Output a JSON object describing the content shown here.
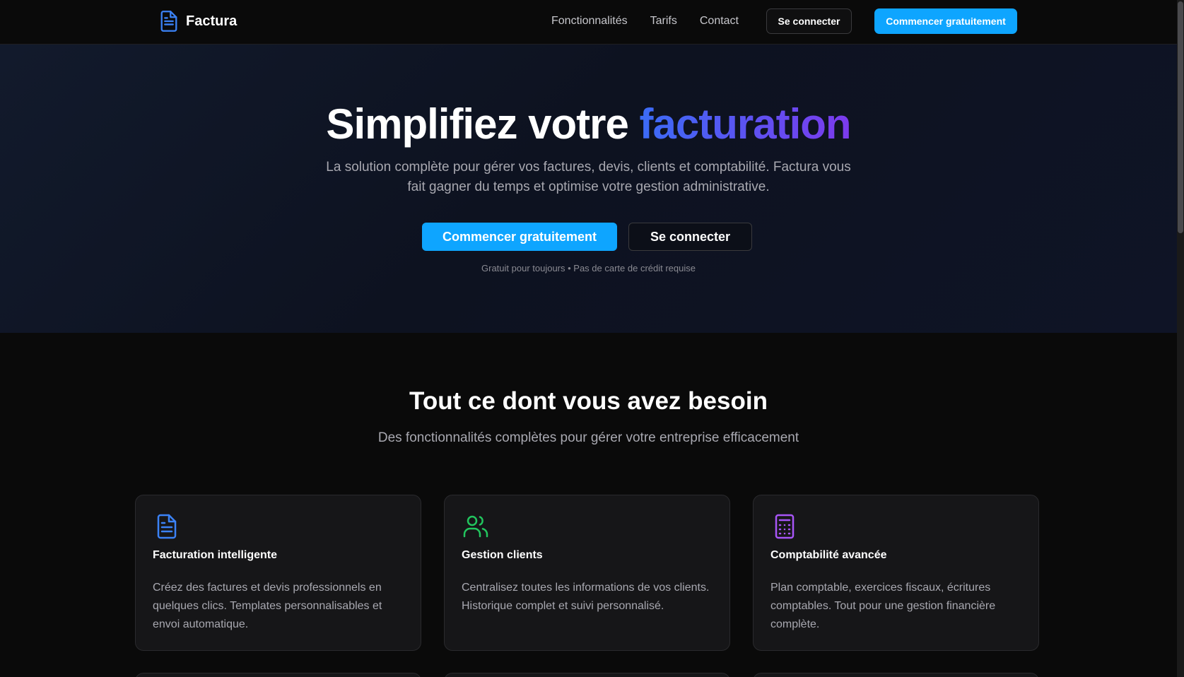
{
  "header": {
    "brand_name": "Factura",
    "nav": [
      "Fonctionnalités",
      "Tarifs",
      "Contact"
    ],
    "login_label": "Se connecter",
    "signup_label": "Commencer gratuitement"
  },
  "hero": {
    "title_main": "Simplifiez votre",
    "title_accent": "facturation",
    "subtitle": "La solution complète pour gérer vos factures, devis, clients et comptabilité. Factura vous fait gagner du temps et optimise votre gestion administrative.",
    "primary_cta": "Commencer gratuitement",
    "secondary_cta": "Se connecter",
    "note": "Gratuit pour toujours • Pas de carte de crédit requise"
  },
  "features": {
    "title": "Tout ce dont vous avez besoin",
    "subtitle": "Des fonctionnalités complètes pour gérer votre entreprise efficacement",
    "cards": [
      {
        "icon": "document-icon",
        "title": "Facturation intelligente",
        "description": "Créez des factures et devis professionnels en quelques clics. Templates personnalisables et envoi automatique."
      },
      {
        "icon": "users-icon",
        "title": "Gestion clients",
        "description": "Centralisez toutes les informations de vos clients. Historique complet et suivi personnalisé."
      },
      {
        "icon": "calculator-icon",
        "title": "Comptabilité avancée",
        "description": "Plan comptable, exercices fiscaux, écritures comptables. Tout pour une gestion financière complète."
      }
    ]
  },
  "colors": {
    "primary": "#0ea5ff",
    "accent_start": "#3b6cf6",
    "accent_end": "#7c3aed",
    "icon_blue": "#3b82f6",
    "icon_green": "#22c55e",
    "icon_purple": "#a855f7"
  }
}
